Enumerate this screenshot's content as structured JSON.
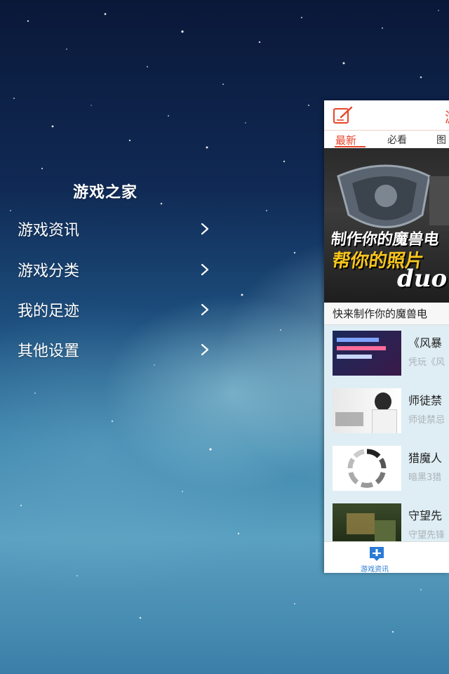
{
  "menu": {
    "title": "游戏之家",
    "items": [
      {
        "label": "游戏资讯"
      },
      {
        "label": "游戏分类"
      },
      {
        "label": "我的足迹"
      },
      {
        "label": "其他设置"
      }
    ]
  },
  "app": {
    "header_title_fragment": "游",
    "tabs": [
      "最新",
      "必看",
      "图"
    ],
    "active_tab": "最新",
    "banner": {
      "line1": "制作你的魔兽电",
      "line2": "帮你的照片",
      "line3": "duo"
    },
    "banner_caption": "快来制作你的魔兽电",
    "news": [
      {
        "title": "《风暴",
        "subtitle": "凭玩《风"
      },
      {
        "title": "师徒禁",
        "subtitle": "师徒禁忌"
      },
      {
        "title": "猎魔人",
        "subtitle": "暗黑3猎"
      },
      {
        "title": "守望先",
        "subtitle": "守望先锋"
      }
    ],
    "bottom_tab_label": "游戏资讯"
  },
  "colors": {
    "accent": "#e8442a",
    "tab_blue": "#2a7bd5",
    "news_row_bg": "#dfeef5"
  },
  "icons": [
    "chevron-right-icon",
    "edit-icon",
    "news-tab-icon"
  ]
}
